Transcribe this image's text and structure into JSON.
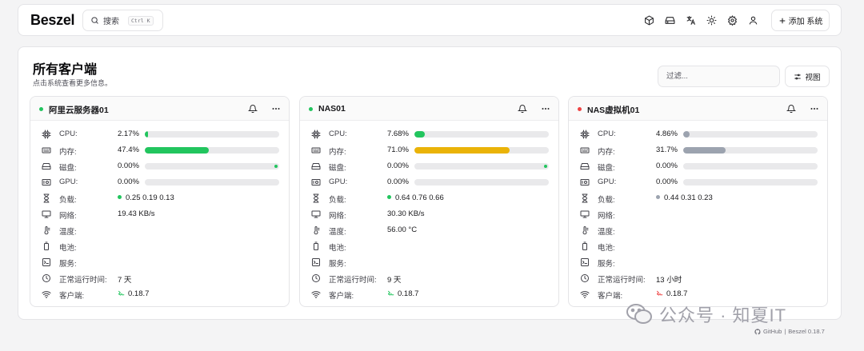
{
  "app": {
    "logo": "Beszel"
  },
  "search": {
    "label": "搜索",
    "kbd_ctrl": "Ctrl",
    "kbd_k": "K"
  },
  "toolbar": {
    "icons": [
      "cube-icon",
      "hard-drive-icon",
      "translate-icon",
      "sun-icon",
      "settings-icon",
      "user-icon"
    ],
    "add_label": "添加 系统"
  },
  "page": {
    "title": "所有客户端",
    "subtitle": "点击系统查看更多信息。",
    "filter_placeholder": "过滤...",
    "view_label": "视图"
  },
  "labels": {
    "cpu": "CPU:",
    "mem": "内存:",
    "disk": "磁盘:",
    "gpu": "GPU:",
    "load": "负载:",
    "net": "网络:",
    "temp": "温度:",
    "battery": "电池:",
    "services": "服务:",
    "uptime": "正常运行时间:",
    "agent": "客户端:"
  },
  "systems": [
    {
      "name": "阿里云服务器01",
      "status_color": "#22c55e",
      "cpu": "2.17%",
      "cpu_pct": 2.17,
      "cpu_color": "#22c55e",
      "mem": "47.4%",
      "mem_pct": 47.4,
      "mem_color": "#22c55e",
      "disk": "0.00%",
      "disk_pct": 0,
      "disk_tip_color": "#22c55e",
      "gpu": "0.00%",
      "gpu_pct": 0,
      "load": "0.25 0.19 0.13",
      "load_color": "#22c55e",
      "net": "19.43 KB/s",
      "temp": "",
      "battery": "",
      "services": "",
      "uptime": "7 天",
      "agent": "0.18.7",
      "agent_color": "#22c55e"
    },
    {
      "name": "NAS01",
      "status_color": "#22c55e",
      "cpu": "7.68%",
      "cpu_pct": 7.68,
      "cpu_color": "#22c55e",
      "mem": "71.0%",
      "mem_pct": 71.0,
      "mem_color": "#eab308",
      "disk": "0.00%",
      "disk_pct": 0,
      "disk_tip_color": "#22c55e",
      "gpu": "0.00%",
      "gpu_pct": 0,
      "load": "0.64 0.76 0.66",
      "load_color": "#22c55e",
      "net": "30.30 KB/s",
      "temp": "56.00 °C",
      "battery": "",
      "services": "",
      "uptime": "9 天",
      "agent": "0.18.7",
      "agent_color": "#22c55e"
    },
    {
      "name": "NAS虚拟机01",
      "status_color": "#ef4444",
      "cpu": "4.86%",
      "cpu_pct": 4.86,
      "cpu_color": "#9ca3af",
      "mem": "31.7%",
      "mem_pct": 31.7,
      "mem_color": "#9ca3af",
      "disk": "0.00%",
      "disk_pct": 0,
      "disk_tip_color": "",
      "gpu": "0.00%",
      "gpu_pct": 0,
      "load": "0.44 0.31 0.23",
      "load_color": "#9ca3af",
      "net": "",
      "temp": "",
      "battery": "",
      "services": "",
      "uptime": "13 小时",
      "agent": "0.18.7",
      "agent_color": "#ef4444"
    }
  ],
  "watermark": {
    "text": "公众号 · 知夏IT"
  },
  "footer": {
    "github": "GitHub",
    "sep": "|",
    "version": "Beszel 0.18.7"
  }
}
